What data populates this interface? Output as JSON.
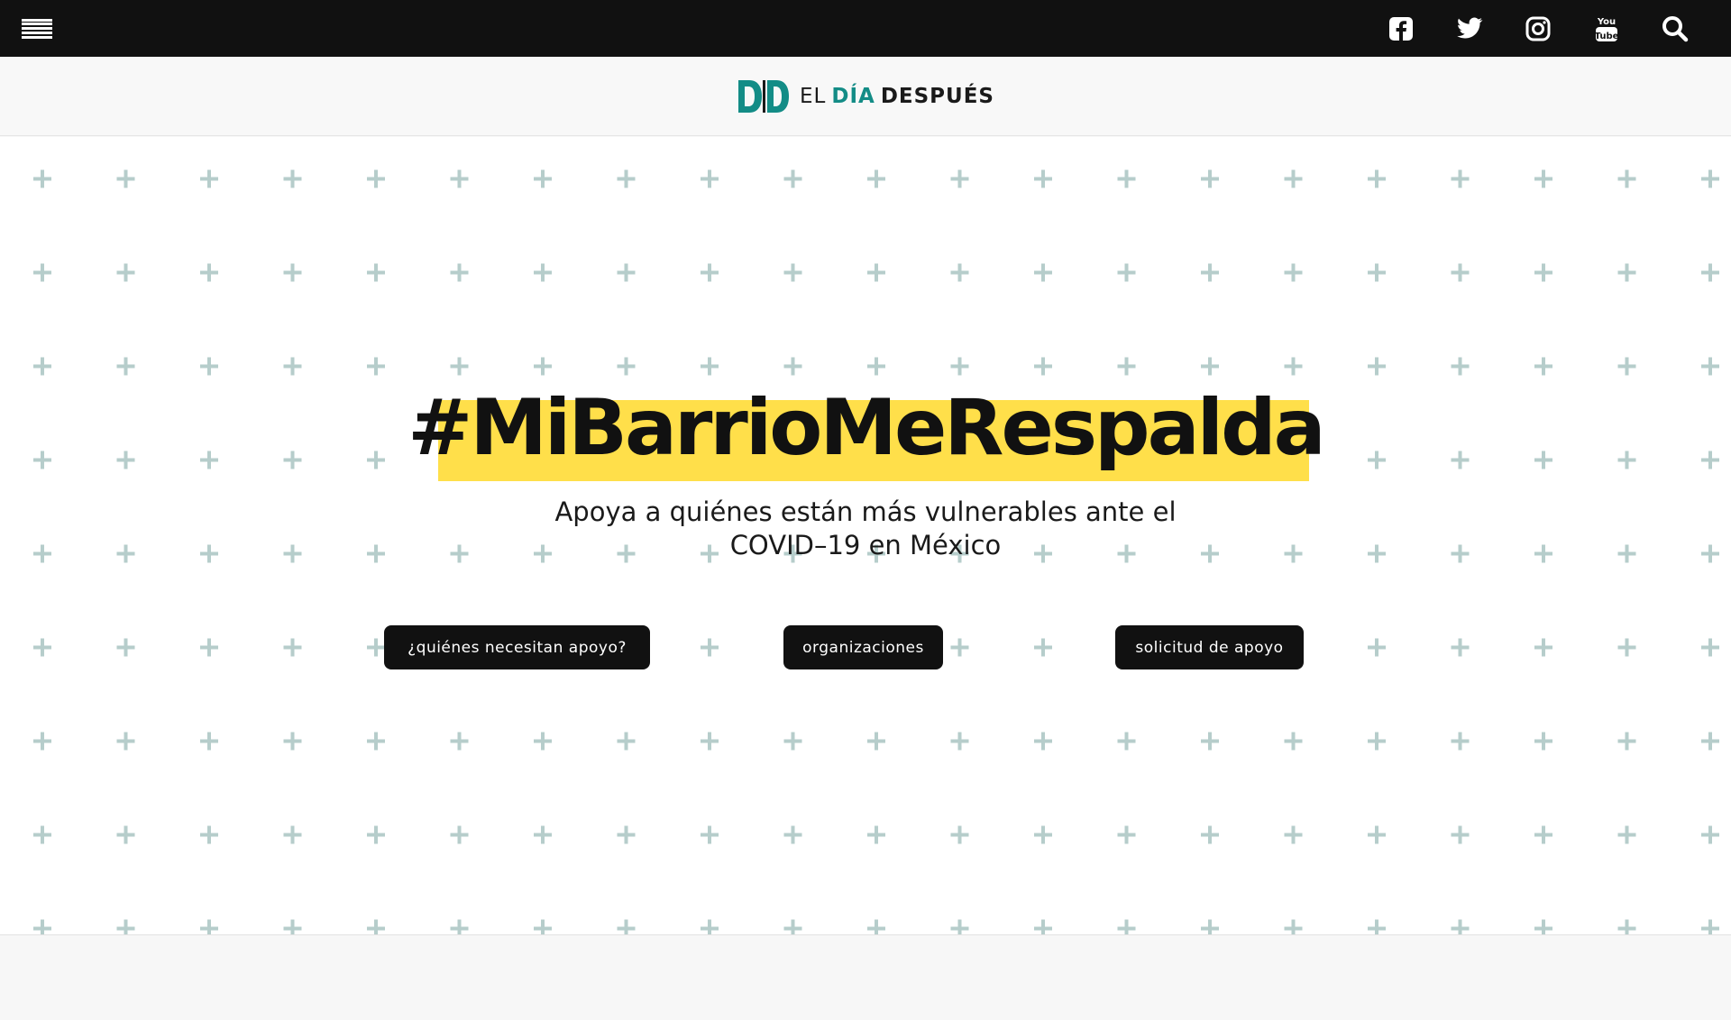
{
  "nav": {
    "menu_icon": "hamburger-menu-icon",
    "social_icons": [
      "facebook-icon",
      "twitter-icon",
      "instagram-icon",
      "youtube-icon",
      "search-icon"
    ]
  },
  "brand": {
    "word1": "EL",
    "word2": "DÍA",
    "word3": "DESPUÉS",
    "accent_color": "#138c86"
  },
  "hero": {
    "headline": "#MiBarrioMeRespalda",
    "subtitle": "Apoya a quiénes están más vulnerables ante el COVID–19 en México",
    "highlight_color": "#ffdf4a",
    "pattern_color": "#b6cdcb"
  },
  "buttons": {
    "need_support": "¿quiénes necesitan apoyo?",
    "organizations": "organizaciones",
    "support_request": "solicitud de apoyo"
  }
}
